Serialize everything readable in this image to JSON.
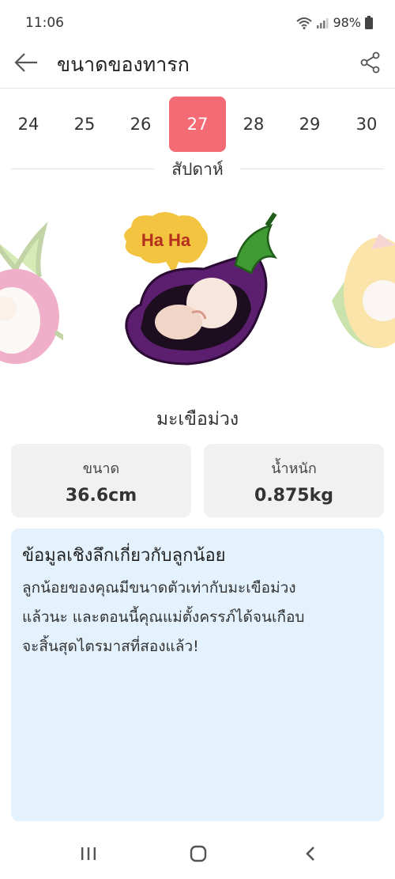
{
  "status": {
    "time": "11:06",
    "battery": "98%"
  },
  "header": {
    "title": "ขนาดของทารก"
  },
  "weeks": {
    "items": [
      "24",
      "25",
      "26",
      "27",
      "28",
      "29",
      "30"
    ],
    "selected": "27",
    "label": "สัปดาห์"
  },
  "illustration": {
    "speech_bubble": "Ha Ha"
  },
  "fruit": {
    "name": "มะเขือม่วง"
  },
  "stats": {
    "size_label": "ขนาด",
    "size_value": "36.6cm",
    "weight_label": "น้ำหนัก",
    "weight_value": "0.875kg"
  },
  "insight": {
    "title": "ข้อมูลเชิงลึกเกี่ยวกับลูกน้อย",
    "body_lines": [
      "ลูกน้อยของคุณมีขนาดตัวเท่ากับมะเขือม่วง",
      "แล้วนะ และตอนนี้คุณแม่ตั้งครรภ์ได้จนเกือบ",
      "จะสิ้นสุดไตรมาสที่สองแล้ว!"
    ]
  },
  "colors": {
    "accent": "#f56b75",
    "insight_bg": "#e4f2fd",
    "card_bg": "#f1f1f1",
    "eggplant": "#5c1e6e"
  },
  "icons": [
    "wifi-icon",
    "signal-icon",
    "battery-icon",
    "back-arrow-icon",
    "share-icon",
    "recent-apps-icon",
    "home-icon",
    "back-nav-icon"
  ]
}
